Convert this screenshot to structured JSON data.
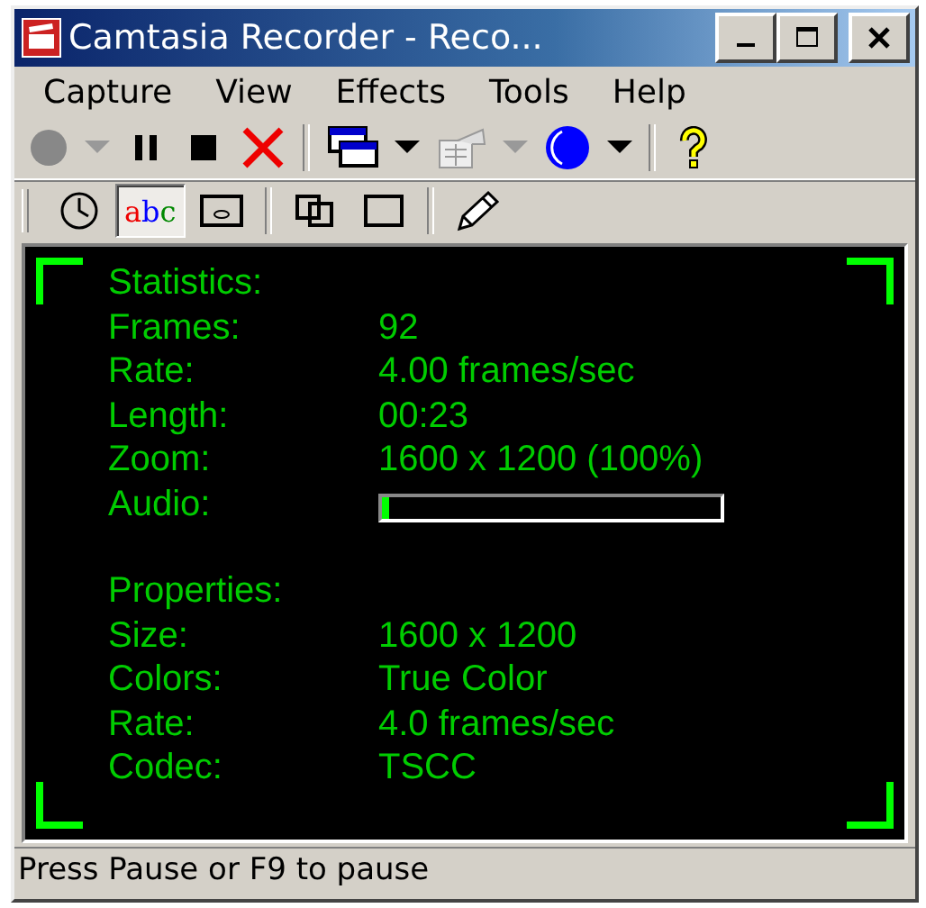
{
  "window": {
    "title": "Camtasia Recorder - Reco..."
  },
  "menu": [
    "Capture",
    "View",
    "Effects",
    "Tools",
    "Help"
  ],
  "toolbar": [
    {
      "kind": "record",
      "disabled": true
    },
    {
      "kind": "dropdown",
      "disabled": true
    },
    {
      "kind": "pause",
      "disabled": false
    },
    {
      "kind": "stop",
      "disabled": false
    },
    {
      "kind": "delete",
      "disabled": false
    },
    {
      "kind": "separator",
      "disabled": false
    },
    {
      "kind": "windows",
      "disabled": false
    },
    {
      "kind": "dropdown",
      "disabled": false
    },
    {
      "kind": "properties",
      "disabled": true
    },
    {
      "kind": "dropdown",
      "disabled": true
    },
    {
      "kind": "moon",
      "disabled": false
    },
    {
      "kind": "dropdown",
      "disabled": false
    },
    {
      "kind": "separator",
      "disabled": false
    },
    {
      "kind": "help",
      "disabled": false
    }
  ],
  "view_toolbar": [
    {
      "kind": "clock",
      "selected": false
    },
    {
      "kind": "text",
      "label": "abc",
      "selected": true
    },
    {
      "kind": "eye",
      "selected": false
    },
    {
      "kind": "separator",
      "selected": false
    },
    {
      "kind": "overlap",
      "selected": false
    },
    {
      "kind": "square",
      "selected": false
    },
    {
      "kind": "separator",
      "selected": false
    },
    {
      "kind": "pencil",
      "selected": false
    }
  ],
  "sections": [
    {
      "heading": "Statistics:",
      "rows": [
        {
          "kind": "text",
          "label": "Frames:",
          "value": "92"
        },
        {
          "kind": "text",
          "label": "Rate:",
          "value": "4.00 frames/sec"
        },
        {
          "kind": "text",
          "label": "Length:",
          "value": "00:23"
        },
        {
          "kind": "text",
          "label": "Zoom:",
          "value": "1600 x 1200 (100%)"
        },
        {
          "kind": "meter",
          "label": "Audio:",
          "level": 0.02
        }
      ]
    },
    {
      "heading": "Properties:",
      "rows": [
        {
          "kind": "text",
          "label": "Size:",
          "value": "1600 x 1200"
        },
        {
          "kind": "text",
          "label": "Colors:",
          "value": "True Color"
        },
        {
          "kind": "text",
          "label": "Rate:",
          "value": "4.0 frames/sec"
        },
        {
          "kind": "text",
          "label": "Codec:",
          "value": "TSCC"
        }
      ]
    }
  ],
  "status_bar": "Press Pause or F9 to pause"
}
